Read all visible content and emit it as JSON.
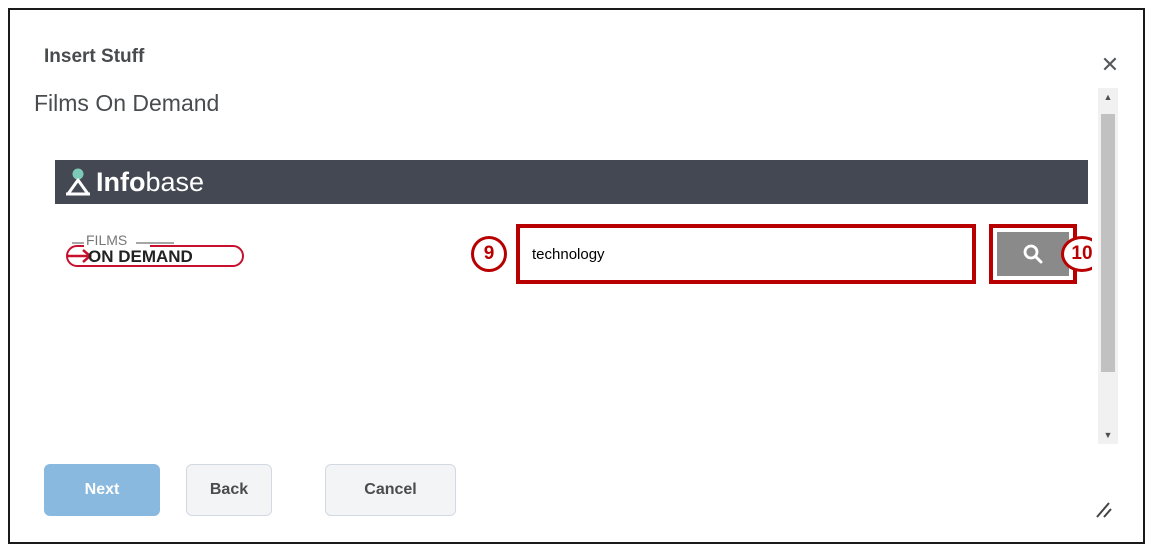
{
  "dialog": {
    "title": "Insert Stuff",
    "close_icon": "close-icon"
  },
  "content": {
    "heading": "Films On Demand",
    "banner": {
      "logo_text_bold": "Info",
      "logo_text_regular": "base",
      "background_color": "#434852"
    },
    "fod_logo": {
      "line1": "FILMS",
      "line2": "ON DEMAND"
    },
    "search": {
      "value": "technology",
      "button_icon": "search-icon"
    },
    "callouts": {
      "search_input": "9",
      "search_button": "10"
    }
  },
  "footer": {
    "next_label": "Next",
    "back_label": "Back",
    "cancel_label": "Cancel"
  },
  "colors": {
    "primary_disabled": "#8ab9e0",
    "callout_red": "#b80000",
    "search_button": "#8a8a8a"
  }
}
